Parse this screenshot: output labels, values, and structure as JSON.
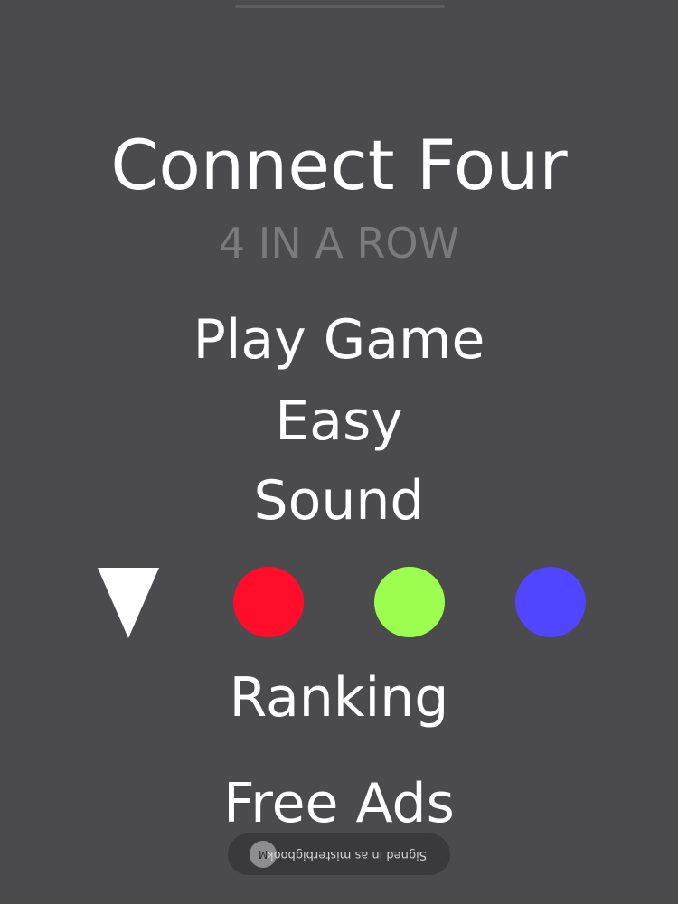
{
  "app": {
    "title": "Connect Four",
    "subtitle": "4 IN A ROW"
  },
  "menu": {
    "play_label": "Play Game",
    "difficulty_label": "Easy",
    "sound_label": "Sound",
    "ranking_label": "Ranking",
    "ads_label": "Free Ads"
  },
  "colors": {
    "background": "#4b4a4c",
    "selected_indicator": "triangle-down-icon",
    "options": [
      {
        "name": "red",
        "hex": "#ff0d2b"
      },
      {
        "name": "green",
        "hex": "#9cff4f"
      },
      {
        "name": "blue",
        "hex": "#5046ff"
      }
    ]
  },
  "signin_toast": {
    "avatar_letter": "M",
    "text": "Signed in as misterbigbook",
    "orientation": "upside-down"
  }
}
